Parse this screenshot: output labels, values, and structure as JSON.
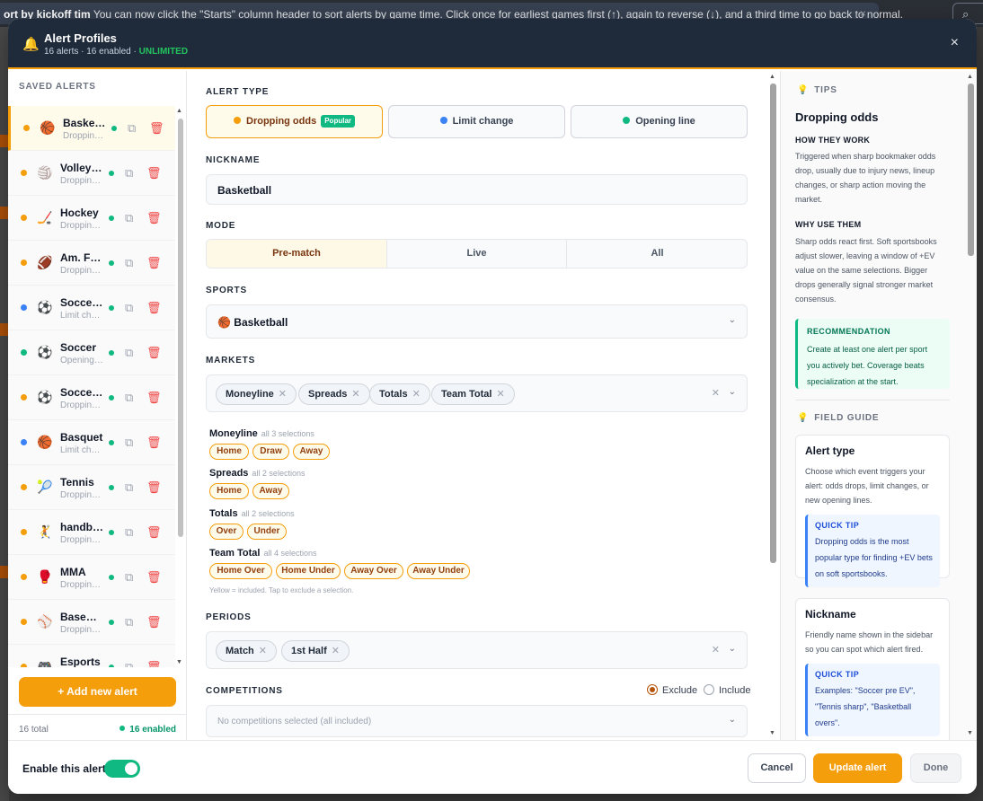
{
  "background": {
    "banner_lead": "ort by kickoff tim",
    "banner_text": "You can now click the \"Starts\" column header to sort alerts by game time. Click once for earliest games first (↑), again to reverse (↓), and a third time to go back to normal.",
    "banner_close": "×",
    "search_glyph": "⌕"
  },
  "header": {
    "title": "Alert Profiles",
    "subtitle": "16 alerts · 16 enabled ·",
    "plan": "UNLIMITED",
    "icon": "bell-icon",
    "close": "×"
  },
  "sidebar": {
    "title": "SAVED ALERTS",
    "items": [
      {
        "name": "Basketball",
        "sub": "Dropping odds",
        "emoji": "🏀",
        "dot": "#f59e0b"
      },
      {
        "name": "Volleyball",
        "sub": "Dropping odds",
        "emoji": "🏐",
        "dot": "#f59e0b"
      },
      {
        "name": "Hockey",
        "sub": "Dropping odds",
        "emoji": "🏒",
        "dot": "#f59e0b"
      },
      {
        "name": "Am. Football",
        "sub": "Dropping odds",
        "emoji": "🏈",
        "dot": "#f59e0b"
      },
      {
        "name": "Soccer pre EV",
        "sub": "Limit change",
        "emoji": "⚽",
        "dot": "#3b82f6"
      },
      {
        "name": "Soccer",
        "sub": "Opening line",
        "emoji": "⚽",
        "dot": "#10b981"
      },
      {
        "name": "Soccer sharp",
        "sub": "Dropping odds",
        "emoji": "⚽",
        "dot": "#f59e0b"
      },
      {
        "name": "Basquet",
        "sub": "Limit change",
        "emoji": "🏀",
        "dot": "#3b82f6"
      },
      {
        "name": "Tennis",
        "sub": "Dropping odds",
        "emoji": "🎾",
        "dot": "#f59e0b"
      },
      {
        "name": "handball",
        "sub": "Dropping odds",
        "emoji": "🤾",
        "dot": "#f59e0b"
      },
      {
        "name": "MMA",
        "sub": "Dropping odds",
        "emoji": "🥊",
        "dot": "#f59e0b"
      },
      {
        "name": "Baseball",
        "sub": "Dropping odds",
        "emoji": "⚾",
        "dot": "#f59e0b"
      },
      {
        "name": "Esports",
        "sub": "Dropping odds",
        "emoji": "🎮",
        "dot": "#f59e0b"
      }
    ],
    "add_button": "+ Add new alert",
    "total": "16 total",
    "enabled": "16 enabled"
  },
  "form": {
    "alert_type_label": "ALERT TYPE",
    "types": [
      {
        "label": "Dropping odds",
        "badge": "Popular",
        "color": "#f59e0b"
      },
      {
        "label": "Limit change",
        "color": "#3b82f6"
      },
      {
        "label": "Opening line",
        "color": "#10b981"
      }
    ],
    "nickname_label": "NICKNAME",
    "nickname_value": "Basketball",
    "mode_label": "MODE",
    "modes": [
      "Pre-match",
      "Live",
      "All"
    ],
    "sports_label": "SPORTS",
    "sport_value": "🏀 Basketball",
    "markets_label": "MARKETS",
    "markets": [
      "Moneyline",
      "Spreads",
      "Totals",
      "Team Total"
    ],
    "groups": [
      {
        "name": "Moneyline",
        "note": "all 3 selections",
        "options": [
          "Home",
          "Draw",
          "Away"
        ]
      },
      {
        "name": "Spreads",
        "note": "all 2 selections",
        "options": [
          "Home",
          "Away"
        ]
      },
      {
        "name": "Totals",
        "note": "all 2 selections",
        "options": [
          "Over",
          "Under"
        ]
      },
      {
        "name": "Team Total",
        "note": "all 4 selections",
        "options": [
          "Home Over",
          "Home Under",
          "Away Over",
          "Away Under"
        ]
      }
    ],
    "hint": "Yellow = included. Tap to exclude a selection.",
    "periods_label": "PERIODS",
    "periods": [
      "Match",
      "1st Half"
    ],
    "competitions_label": "COMPETITIONS",
    "exclude_label": "Exclude",
    "include_label": "Include",
    "competitions_placeholder": "No competitions selected (all included)",
    "clear_glyph": "✕",
    "chevron_glyph": "⌄",
    "chip_remove_glyph": "✕"
  },
  "tips": {
    "title": "TIPS",
    "heading": "Dropping odds",
    "how_title": "HOW THEY WORK",
    "how_text": "Triggered when sharp bookmaker odds drop, usually due to injury news, lineup changes, or sharp action moving the market.",
    "why_title": "WHY USE THEM",
    "why_text": "Sharp odds react first. Soft sportsbooks adjust slower, leaving a window of +EV value on the same selections. Bigger drops generally signal stronger market consensus.",
    "reco_title": "RECOMMENDATION",
    "reco_text": "Create at least one alert per sport you actively bet. Coverage beats specialization at the start.",
    "field_guide_title": "FIELD GUIDE",
    "cards": [
      {
        "title": "Alert type",
        "text": "Choose which event triggers your alert: odds drops, limit changes, or new opening lines.",
        "quick_title": "QUICK TIP",
        "quick_text": "Dropping odds is the most popular type for finding +EV bets on soft sportsbooks."
      },
      {
        "title": "Nickname",
        "text": "Friendly name shown in the sidebar so you can spot which alert fired.",
        "quick_title": "QUICK TIP",
        "quick_text": "Examples: \"Soccer pre EV\", \"Tennis sharp\", \"Basketball overs\"."
      }
    ]
  },
  "footer": {
    "enable_label": "Enable this alert",
    "enabled": true,
    "cancel": "Cancel",
    "update": "Update alert",
    "done": "Done"
  },
  "colors": {
    "accent": "#f59e0b",
    "header_bg": "#1f2a3a",
    "enabled_green": "#10b981",
    "limit_blue": "#3b82f6",
    "delete_red": "#ef4444"
  }
}
